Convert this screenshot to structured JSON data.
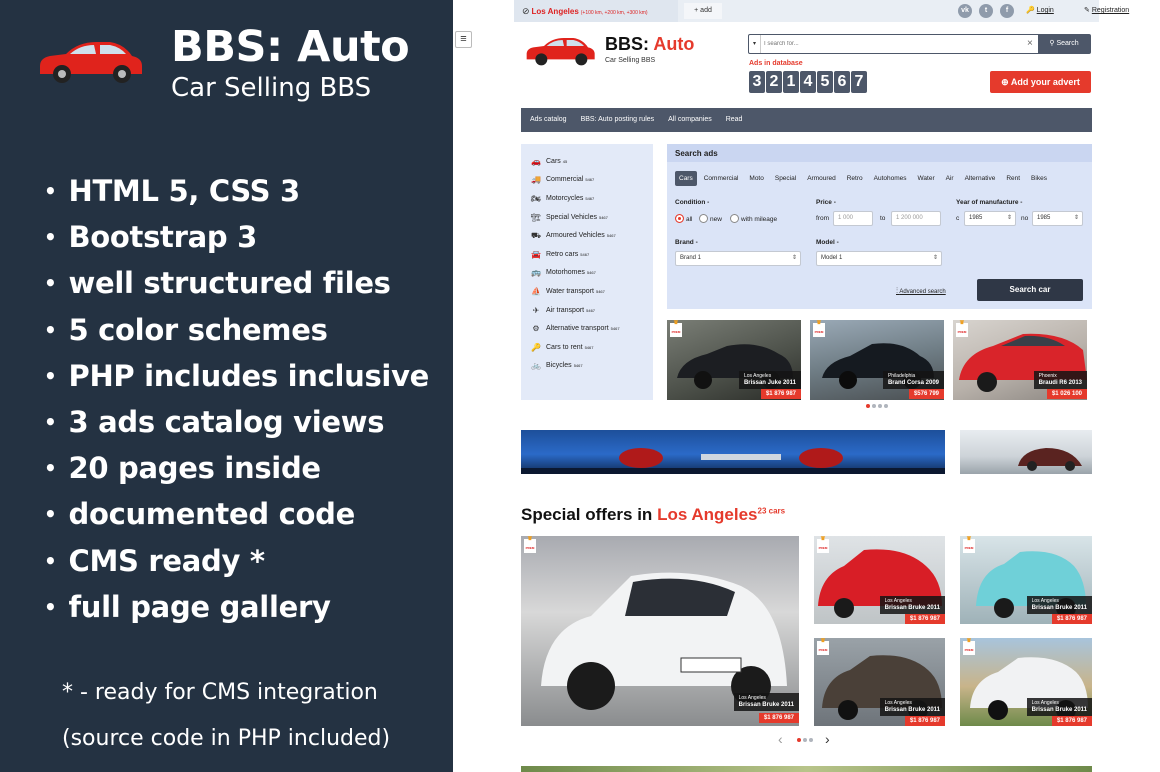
{
  "promo": {
    "title": "BBS: Auto",
    "subtitle": "Car Selling BBS",
    "features": [
      "HTML 5, CSS 3",
      "Bootstrap 3",
      "well structured files",
      "5 color schemes",
      "PHP includes inclusive",
      "3 ads catalog views",
      "20 pages inside",
      "documented code",
      "CMS ready *",
      "full page gallery"
    ],
    "note1": "* - ready for CMS integration",
    "note2": "(source code in PHP included)"
  },
  "topbar": {
    "location": "Los Angeles",
    "radius": "(+100 km, +200 km, +300 km)",
    "add": "+ add",
    "social": [
      "vk",
      "t",
      "f"
    ],
    "login": "Login",
    "registration": "Registration"
  },
  "site": {
    "name_a": "BBS:",
    "name_b": "Auto",
    "tagline": "Car Selling BBS",
    "search_placeholder": "I search for...",
    "search_button": "Search",
    "ads_label": "Ads in database",
    "counter": [
      "3",
      "2",
      "1",
      "4",
      "5",
      "6",
      "7"
    ],
    "add_advert": "Add your advert"
  },
  "nav": [
    "Ads catalog",
    "BBS: Auto posting rules",
    "All companies",
    "Read"
  ],
  "categories": [
    {
      "label": "Cars",
      "count": "45",
      "icon": "car-icon",
      "glyph": "🚗"
    },
    {
      "label": "Commercial",
      "count": "5467",
      "icon": "truck-icon",
      "glyph": "🚚"
    },
    {
      "label": "Motorcycles",
      "count": "5467",
      "icon": "motorcycle-icon",
      "glyph": "🏍"
    },
    {
      "label": "Special Vehicles",
      "count": "5467",
      "icon": "crane-icon",
      "glyph": "🏗"
    },
    {
      "label": "Armoured Vehicles",
      "count": "5467",
      "icon": "tank-icon",
      "glyph": "⛟"
    },
    {
      "label": "Retro cars",
      "count": "5467",
      "icon": "retro-car-icon",
      "glyph": "🚘"
    },
    {
      "label": "Motorhomes",
      "count": "5467",
      "icon": "motorhome-icon",
      "glyph": "🚌"
    },
    {
      "label": "Water transport",
      "count": "5467",
      "icon": "boat-icon",
      "glyph": "⛵"
    },
    {
      "label": "Air transport",
      "count": "5467",
      "icon": "plane-icon",
      "glyph": "✈"
    },
    {
      "label": "Alternative transport",
      "count": "5467",
      "icon": "alt-transport-icon",
      "glyph": "⚙"
    },
    {
      "label": "Cars to rent",
      "count": "5467",
      "icon": "rent-icon",
      "glyph": "🔑"
    },
    {
      "label": "Bicycles",
      "count": "5467",
      "icon": "bicycle-icon",
      "glyph": "🚲"
    }
  ],
  "search": {
    "header": "Search ads",
    "tabs": [
      "Cars",
      "Commercial",
      "Moto",
      "Special",
      "Armoured",
      "Retro",
      "Autohomes",
      "Water",
      "Air",
      "Alternative",
      "Rent",
      "Bikes"
    ],
    "condition_label": "Condition -",
    "cond_all": "all",
    "cond_new": "new",
    "cond_mileage": "with mileage",
    "price_label": "Price -",
    "from": "from",
    "to": "to",
    "price_from_ph": "1 000",
    "price_to_ph": "1 200 000",
    "year_label": "Year of manufacture -",
    "c": "c",
    "no": "no",
    "year_from": "1985",
    "year_to": "1985",
    "brand_label": "Brand -",
    "brand_value": "Brand 1",
    "model_label": "Model -",
    "model_value": "Model 1",
    "advanced": "Advanced search",
    "submit": "Search car"
  },
  "featured": [
    {
      "city": "Los Angeles",
      "name": "Brissan Juke 2011",
      "price": "$1 876 987"
    },
    {
      "city": "Philadelphia",
      "name": "Brand Corsa 2009",
      "price": "$576 799"
    },
    {
      "city": "Phoenix",
      "name": "Braudi R6 2013",
      "price": "$1 026 100"
    }
  ],
  "prem": "PREM",
  "special": {
    "title": "Special offers in",
    "city": "Los Angeles",
    "count": "23 cars",
    "big": {
      "city": "Los Angeles",
      "name": "Brissan Bruke 2011",
      "price": "$1 876 987"
    },
    "small": [
      {
        "city": "Los Angeles",
        "name": "Brissan Bruke 2011",
        "price": "$1 876 987"
      },
      {
        "city": "Los Angeles",
        "name": "Brissan Bruke 2011",
        "price": "$1 876 987"
      },
      {
        "city": "Los Angeles",
        "name": "Brissan Bruke 2011",
        "price": "$1 876 987"
      },
      {
        "city": "Los Angeles",
        "name": "Brissan Bruke 2011",
        "price": "$1 876 987"
      }
    ]
  },
  "colors": {
    "accent": "#e53a2c",
    "dark": "#4d5769",
    "panel": "#243242"
  }
}
